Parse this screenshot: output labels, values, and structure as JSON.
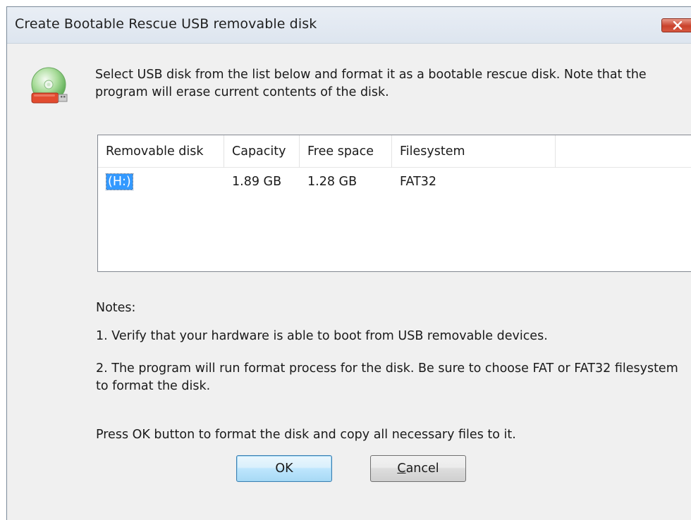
{
  "window": {
    "title": "Create Bootable Rescue USB removable disk",
    "close_icon": "close-icon",
    "app_icon": "usb-rescue-disk-icon"
  },
  "intro_text": "Select USB disk from the list below and format it as a bootable rescue disk. Note that the program will erase current contents of the disk.",
  "disk_list": {
    "columns": [
      "Removable disk",
      "Capacity",
      "Free space",
      "Filesystem"
    ],
    "rows": [
      {
        "disk": "(H:)",
        "capacity": "1.89 GB",
        "free_space": "1.28 GB",
        "filesystem": "FAT32",
        "selected": true
      }
    ]
  },
  "notes": {
    "title": "Notes:",
    "items": [
      "1. Verify that your hardware is able to boot from USB removable devices.",
      "2. The program will run format process for the disk. Be sure to choose FAT or FAT32 filesystem to format the disk.",
      "Press OK button to format the disk and copy all necessary files to it."
    ]
  },
  "buttons": {
    "ok_label": "OK",
    "cancel_first_letter": "C",
    "cancel_rest": "ancel"
  },
  "colors": {
    "selection": "#3399ff",
    "close_button": "#c9412b",
    "dialog_background": "#f0f0f0"
  }
}
